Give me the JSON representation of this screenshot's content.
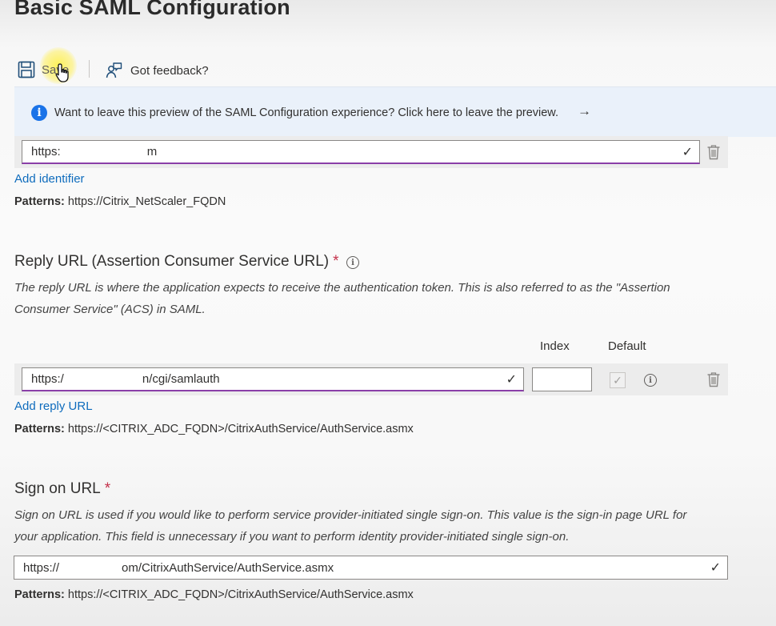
{
  "page": {
    "title": "Basic SAML Configuration"
  },
  "toolbar": {
    "save_label": "Save",
    "feedback_label": "Got feedback?"
  },
  "banner": {
    "text": "Want to leave this preview of the SAML Configuration experience? Click here to leave the preview.",
    "arrow": "→",
    "icon": "i"
  },
  "identifier": {
    "value_prefix": "https:",
    "value_suffix": "m",
    "check": "✓",
    "add_label": "Add identifier",
    "pattern_label": "Patterns:",
    "pattern_value": "https://Citrix_NetScaler_FQDN"
  },
  "reply": {
    "label": "Reply URL (Assertion Consumer Service URL)",
    "required": "*",
    "info": "i",
    "description_line1": "The reply URL is where the application expects to receive the authentication token. This is also referred to as the \"Assertion",
    "description_line2": "Consumer Service\" (ACS) in SAML.",
    "index_header": "Index",
    "default_header": "Default",
    "value_prefix": "https:/",
    "value_suffix": "n/cgi/samlauth",
    "check": "✓",
    "index_value": "",
    "default_check": "✓",
    "default_info": "i",
    "add_label": "Add reply URL",
    "pattern_label": "Patterns:",
    "pattern_value": "https://<CITRIX_ADC_FQDN>/CitrixAuthService/AuthService.asmx"
  },
  "signon": {
    "label": "Sign on URL",
    "required": "*",
    "description_line1": "Sign on URL is used if you would like to perform service provider-initiated single sign-on. This value is the sign-in page URL for",
    "description_line2": "your application. This field is unnecessary if you want to perform identity provider-initiated single sign-on.",
    "value_prefix": "https://",
    "value_suffix": "om/CitrixAuthService/AuthService.asmx",
    "check": "✓",
    "pattern_label": "Patterns:",
    "pattern_value": "https://<CITRIX_ADC_FQDN>/CitrixAuthService/AuthService.asmx"
  },
  "colors": {
    "accent_link": "#0f6cbd",
    "input_focus_border": "#8a3fa8",
    "banner_bg": "#eaf1fa",
    "info_icon": "#1a73e8",
    "required": "#c4314b"
  },
  "icons": {
    "save": "save-icon",
    "feedback": "feedback-icon",
    "info": "info-icon",
    "delete": "trash-icon",
    "cursor": "hand-cursor-icon"
  }
}
